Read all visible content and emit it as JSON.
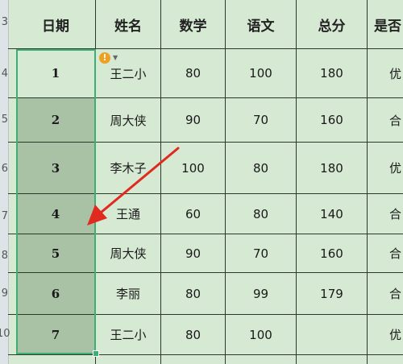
{
  "row_numbers": [
    "3",
    "4",
    "5",
    "6",
    "7",
    "8",
    "9",
    "10"
  ],
  "headers": [
    "日期",
    "姓名",
    "数学",
    "语文",
    "总分",
    "是否"
  ],
  "rows": [
    {
      "date": "1",
      "name": "王二小",
      "math": "80",
      "chinese": "100",
      "total": "180",
      "status": "优"
    },
    {
      "date": "2",
      "name": "周大侠",
      "math": "90",
      "chinese": "70",
      "total": "160",
      "status": "合"
    },
    {
      "date": "3",
      "name": "李木子",
      "math": "100",
      "chinese": "80",
      "total": "180",
      "status": "优"
    },
    {
      "date": "4",
      "name": "王通",
      "math": "60",
      "chinese": "80",
      "total": "140",
      "status": "合"
    },
    {
      "date": "5",
      "name": "周大侠",
      "math": "90",
      "chinese": "70",
      "total": "160",
      "status": "合"
    },
    {
      "date": "6",
      "name": "李丽",
      "math": "80",
      "chinese": "99",
      "total": "179",
      "status": "合"
    },
    {
      "date": "7",
      "name": "王二小",
      "math": "80",
      "chinese": "100",
      "total": "",
      "status": "优"
    }
  ],
  "warning_icon": {
    "name": "exclamation-icon",
    "glyph": "!",
    "color": "#f0a020"
  },
  "selection_color": "#3fae73",
  "arrow_color": "#e02a1f"
}
